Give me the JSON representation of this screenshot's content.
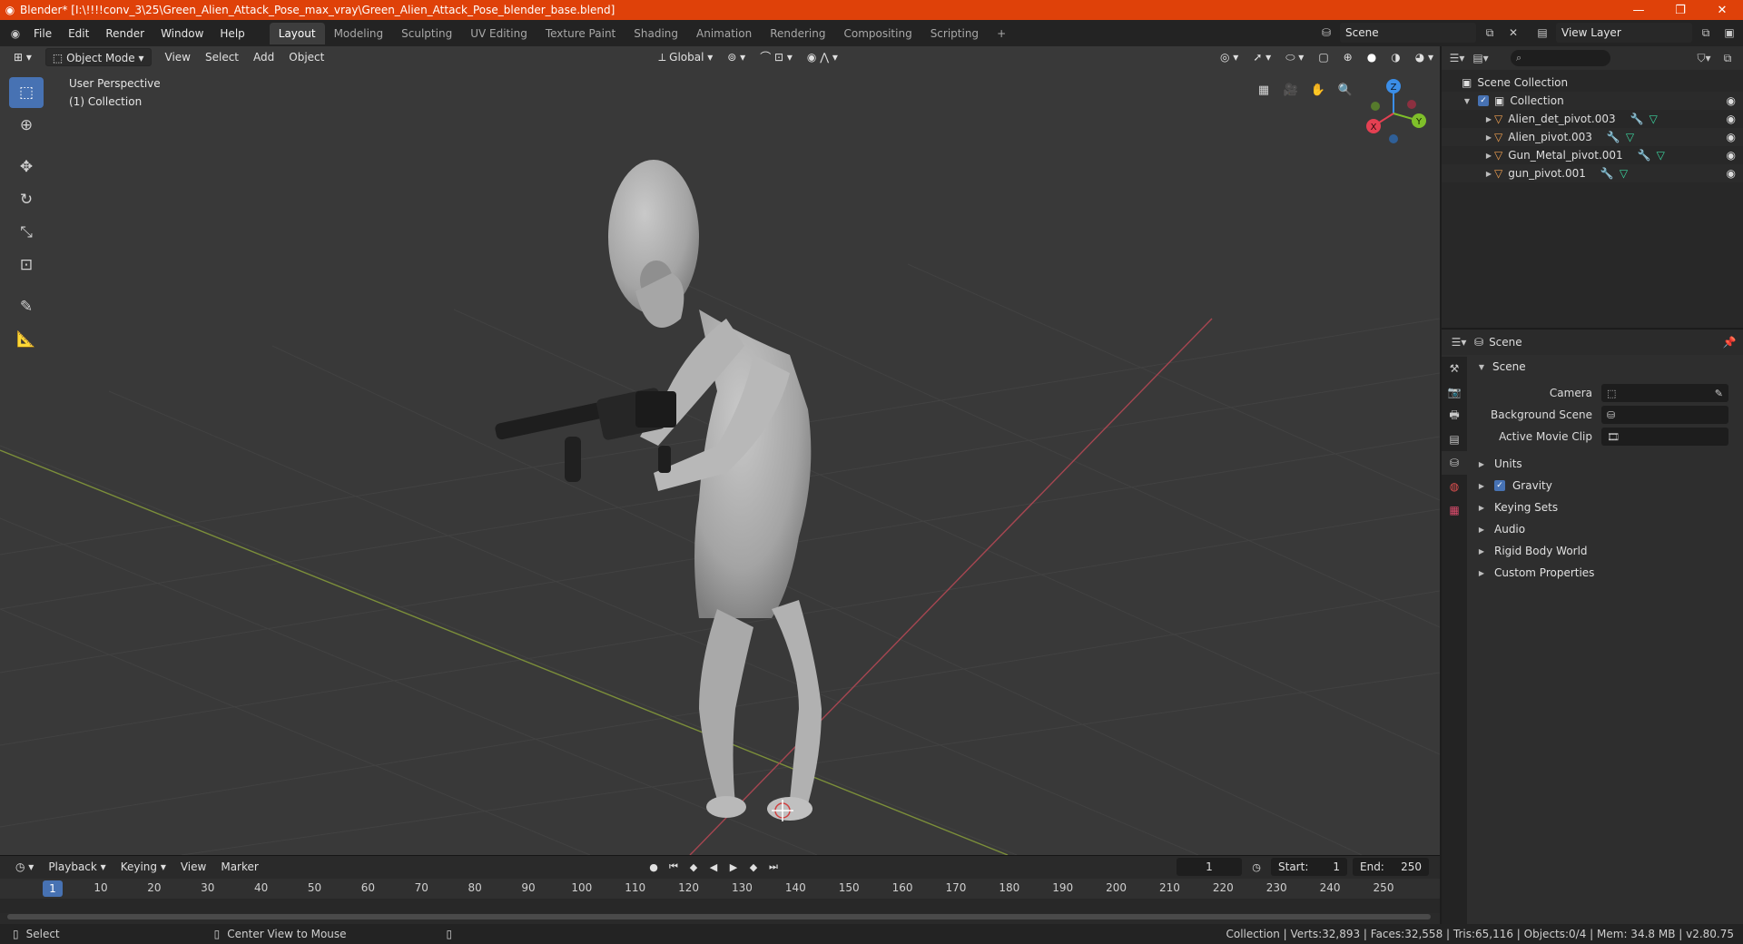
{
  "window": {
    "title": "Blender* [I:\\!!!!conv_3\\25\\Green_Alien_Attack_Pose_max_vray\\Green_Alien_Attack_Pose_blender_base.blend]"
  },
  "menu": [
    "File",
    "Edit",
    "Render",
    "Window",
    "Help"
  ],
  "workspaces": [
    "Layout",
    "Modeling",
    "Sculpting",
    "UV Editing",
    "Texture Paint",
    "Shading",
    "Animation",
    "Rendering",
    "Compositing",
    "Scripting"
  ],
  "active_workspace": "Layout",
  "topbar": {
    "scene": "Scene",
    "view_layer": "View Layer"
  },
  "viewport": {
    "mode": "Object Mode",
    "menus": [
      "View",
      "Select",
      "Add",
      "Object"
    ],
    "orientation": "Global",
    "overlay_line1": "User Perspective",
    "overlay_line2": "(1) Collection",
    "gizmo": {
      "z": "Z",
      "y": "Y",
      "x": "X"
    }
  },
  "timeline": {
    "menus": [
      "Playback",
      "Keying",
      "View",
      "Marker"
    ],
    "current_frame": "1",
    "start_label": "Start:",
    "start": "1",
    "end_label": "End:",
    "end": "250",
    "ticks": [
      "10",
      "20",
      "30",
      "40",
      "50",
      "60",
      "70",
      "80",
      "90",
      "100",
      "110",
      "120",
      "130",
      "140",
      "150",
      "160",
      "170",
      "180",
      "190",
      "200",
      "210",
      "220",
      "230",
      "240",
      "250"
    ],
    "playhead": "1"
  },
  "statusbar": {
    "left": "Select",
    "middle": "Center View to Mouse",
    "right": "Collection | Verts:32,893 | Faces:32,558 | Tris:65,116 | Objects:0/4 | Mem: 34.8 MB | v2.80.75"
  },
  "outliner": {
    "root": "Scene Collection",
    "collection": "Collection",
    "items": [
      "Alien_det_pivot.003",
      "Alien_pivot.003",
      "Gun_Metal_pivot.001",
      "gun_pivot.001"
    ]
  },
  "properties": {
    "context": "Scene",
    "panel_title": "Scene",
    "rows": [
      {
        "label": "Camera"
      },
      {
        "label": "Background Scene"
      },
      {
        "label": "Active Movie Clip"
      }
    ],
    "subpanels": [
      "Units",
      "Gravity",
      "Keying Sets",
      "Audio",
      "Rigid Body World",
      "Custom Properties"
    ]
  },
  "colors": {
    "titlebar": "#df4109",
    "accent": "#4772b3",
    "x_axis": "#e44052",
    "y_axis": "#7fbf2a",
    "z_axis": "#3b8ee8"
  }
}
